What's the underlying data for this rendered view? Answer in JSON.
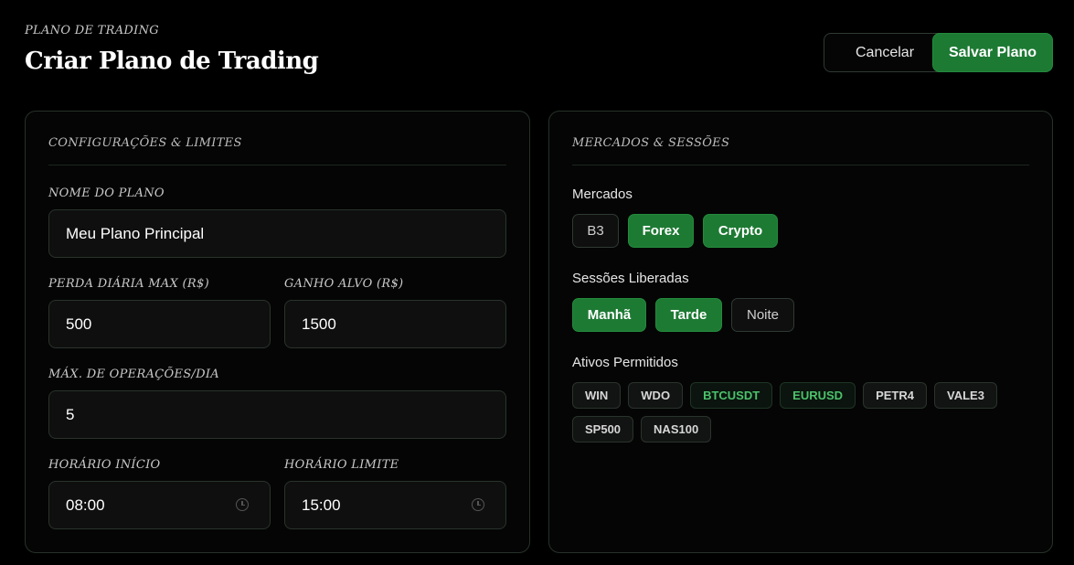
{
  "header": {
    "eyebrow": "PLANO DE TRADING",
    "title": "Criar Plano de Trading",
    "cancel_label": "Cancelar",
    "save_label": "Salvar Plano"
  },
  "config": {
    "section_title": "CONFIGURAÇÕES & LIMITES",
    "plan_name_label": "NOME DO PLANO",
    "plan_name_value": "Meu Plano Principal",
    "max_loss_label": "PERDA DIÁRIA MAX (R$)",
    "max_loss_value": "500",
    "target_gain_label": "GANHO ALVO (R$)",
    "target_gain_value": "1500",
    "max_ops_label": "MÁX. DE OPERAÇÕES/DIA",
    "max_ops_value": "5",
    "start_time_label": "HORÁRIO INÍCIO",
    "start_time_value": "08:00",
    "end_time_label": "HORÁRIO LIMITE",
    "end_time_value": "15:00"
  },
  "markets": {
    "section_title": "MERCADOS & SESSÕES",
    "markets_label": "Mercados",
    "market_items": [
      {
        "label": "B3",
        "selected": false
      },
      {
        "label": "Forex",
        "selected": true
      },
      {
        "label": "Crypto",
        "selected": true
      }
    ],
    "sessions_label": "Sessões Liberadas",
    "session_items": [
      {
        "label": "Manhã",
        "selected": true
      },
      {
        "label": "Tarde",
        "selected": true
      },
      {
        "label": "Noite",
        "selected": false
      }
    ],
    "assets_label": "Ativos Permitidos",
    "asset_items": [
      "WIN",
      "WDO",
      "BTCUSDT",
      "EURUSD",
      "PETR4",
      "VALE3",
      "SP500",
      "NAS100"
    ]
  },
  "colors": {
    "accent": "#1d7a33",
    "accent_text": "#4cc26b",
    "background": "#000000",
    "panel": "#050505"
  },
  "icons": {
    "time_input": "clock-icon"
  }
}
